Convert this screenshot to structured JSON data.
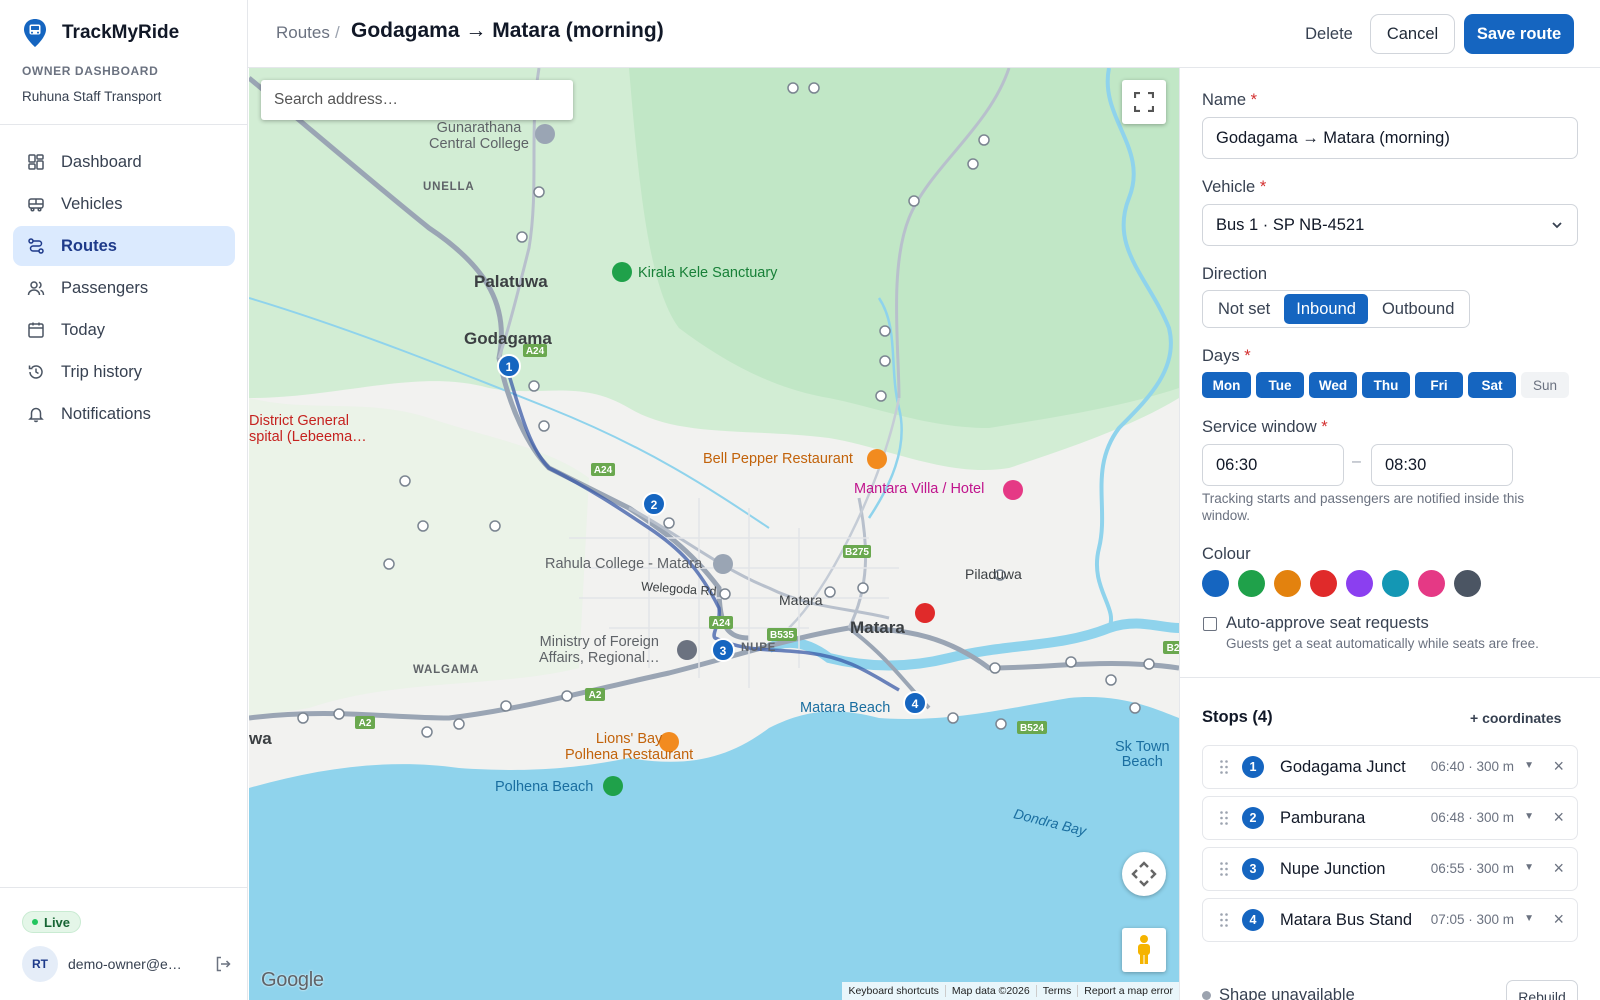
{
  "app": {
    "name": "TrackMyRide",
    "section_label": "OWNER DASHBOARD",
    "org_name": "Ruhuna Staff Transport"
  },
  "sidebar": {
    "items": [
      {
        "label": "Dashboard",
        "icon": "dashboard-icon",
        "active": false
      },
      {
        "label": "Vehicles",
        "icon": "bus-icon",
        "active": false
      },
      {
        "label": "Routes",
        "icon": "route-icon",
        "active": true
      },
      {
        "label": "Passengers",
        "icon": "users-icon",
        "active": false
      },
      {
        "label": "Today",
        "icon": "calendar-icon",
        "active": false
      },
      {
        "label": "Trip history",
        "icon": "history-icon",
        "active": false
      },
      {
        "label": "Notifications",
        "icon": "bell-icon",
        "active": false
      }
    ],
    "status_badge": "Live",
    "user": {
      "initials": "RT",
      "email": "demo-owner@e…"
    }
  },
  "header": {
    "breadcrumb_parent": "Routes",
    "breadcrumb_separator": "/",
    "title": "Godagama → Matara (morning)",
    "delete_label": "Delete",
    "cancel_label": "Cancel",
    "save_label": "Save route"
  },
  "map": {
    "search_placeholder": "Search address…",
    "labels": {
      "gunarathana": "Gunarathana\nCentral College",
      "unella": "UNELLA",
      "kirala": "Kirala Kele Sanctuary",
      "palatuwa": "Palatuwa",
      "godagama": "Godagama",
      "hospital": "District General\nspital (Lebeema…",
      "bellpepper": "Bell Pepper Restaurant",
      "mantara": "Mantara Villa / Hotel",
      "rahula": "Rahula College - Matara",
      "welegoda": "Welegoda Rd",
      "matara_small": "Matara",
      "matara": "Matara",
      "piladuwa": "Piladuwa",
      "ministry": "Ministry of Foreign\nAffairs, Regional…",
      "nupe": "NUPE",
      "walgama": "WALGAMA",
      "matarabeach": "Matara Beach",
      "lionsbay": "Lions' Bay\nPolhena Restaurant",
      "polhena": "Polhena Beach",
      "sktown": "Sk Town\nBeach",
      "dondra": "Dondra Bay",
      "wa": "wa"
    },
    "road_labels": [
      "A24",
      "A24",
      "A24",
      "B275",
      "B535",
      "A2",
      "A2",
      "B524",
      "B2"
    ],
    "footer": [
      "Keyboard shortcuts",
      "Map data ©2026",
      "Terms",
      "Report a map error"
    ],
    "logo": "Google"
  },
  "form": {
    "name_label": "Name",
    "name_value": "Godagama → Matara (morning)",
    "vehicle_label": "Vehicle",
    "vehicle_value": "Bus 1 · SP NB-4521",
    "direction_label": "Direction",
    "direction_options": [
      "Not set",
      "Inbound",
      "Outbound"
    ],
    "direction_selected": "Inbound",
    "days_label": "Days",
    "days": [
      {
        "label": "Mon",
        "on": true
      },
      {
        "label": "Tue",
        "on": true
      },
      {
        "label": "Wed",
        "on": true
      },
      {
        "label": "Thu",
        "on": true
      },
      {
        "label": "Fri",
        "on": true
      },
      {
        "label": "Sat",
        "on": true
      },
      {
        "label": "Sun",
        "on": false
      }
    ],
    "window_label": "Service window",
    "window_start": "06:30",
    "window_sep": "–",
    "window_end": "08:30",
    "window_hint": "Tracking starts and passengers are notified inside this window.",
    "colour_label": "Colour",
    "colours": [
      "#1565c0",
      "#1fa14a",
      "#e3820e",
      "#e02a2a",
      "#8b3ff0",
      "#1497b4",
      "#e53985",
      "#4b5563"
    ],
    "auto_approve_label": "Auto-approve seat requests",
    "auto_approve_hint": "Guests get a seat automatically while seats are free.",
    "auto_approve_checked": false
  },
  "stops": {
    "title": "Stops (4)",
    "add_coords_label": "+ coordinates",
    "items": [
      {
        "num": "1",
        "name": "Godagama Junct",
        "meta": "06:40 · 300 m"
      },
      {
        "num": "2",
        "name": "Pamburana",
        "meta": "06:48 · 300 m"
      },
      {
        "num": "3",
        "name": "Nupe Junction",
        "meta": "06:55 · 300 m"
      },
      {
        "num": "4",
        "name": "Matara Bus Stand",
        "meta": "07:05 · 300 m"
      }
    ],
    "shape_status": "Shape unavailable",
    "rebuild_label": "Rebuild"
  },
  "colors": {
    "accent": "#1565c0",
    "active_nav_bg": "#dbeafe",
    "required": "#d32f2f",
    "live": "#22c55e"
  }
}
